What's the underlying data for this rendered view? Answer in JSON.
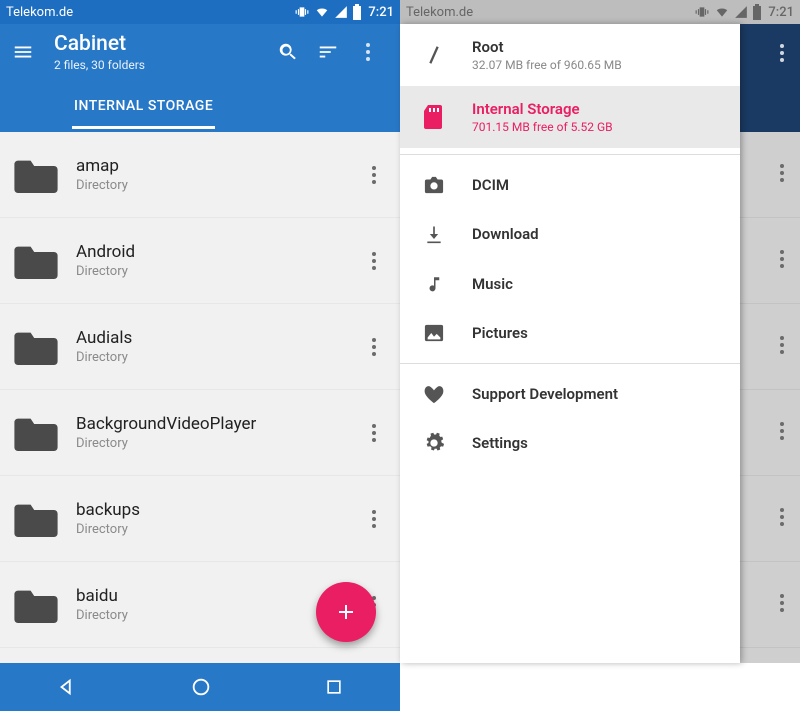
{
  "status": {
    "carrier": "Telekom.de",
    "time": "7:21"
  },
  "colors": {
    "primary": "#2878c8",
    "accent": "#e91e63",
    "appbar_dark": "#1a3a63"
  },
  "left": {
    "app_title": "Cabinet",
    "subtitle": "2 files, 30 folders",
    "tab_label": "INTERNAL STORAGE",
    "folders": [
      {
        "name": "amap",
        "kind": "Directory"
      },
      {
        "name": "Android",
        "kind": "Directory"
      },
      {
        "name": "Audials",
        "kind": "Directory"
      },
      {
        "name": "BackgroundVideoPlayer",
        "kind": "Directory"
      },
      {
        "name": "backups",
        "kind": "Directory"
      },
      {
        "name": "baidu",
        "kind": "Directory"
      }
    ],
    "fab_label": "+"
  },
  "drawer": {
    "storages": [
      {
        "icon": "slash-icon",
        "title": "Root",
        "subtitle": "32.07 MB free of 960.65 MB",
        "selected": false
      },
      {
        "icon": "sdcard-icon",
        "title": "Internal Storage",
        "subtitle": "701.15 MB free of 5.52 GB",
        "selected": true
      }
    ],
    "shortcuts": [
      {
        "icon": "camera-icon",
        "label": "DCIM"
      },
      {
        "icon": "download-icon",
        "label": "Download"
      },
      {
        "icon": "music-icon",
        "label": "Music"
      },
      {
        "icon": "image-icon",
        "label": "Pictures"
      }
    ],
    "footer": [
      {
        "icon": "heart-icon",
        "label": "Support Development"
      },
      {
        "icon": "gear-icon",
        "label": "Settings"
      }
    ]
  }
}
